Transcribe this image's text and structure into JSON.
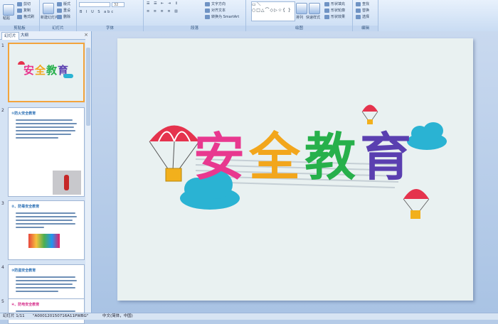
{
  "ribbon": {
    "clipboard": {
      "paste": "粘贴",
      "cut": "剪切",
      "copy": "复制",
      "format_painter": "格式刷",
      "group": "剪贴板"
    },
    "slides": {
      "new_slide": "新建幻灯片",
      "layout": "版式",
      "reset": "重设",
      "delete": "删除",
      "group": "幻灯片"
    },
    "font": {
      "font_size": "32",
      "group": "字体"
    },
    "paragraph": {
      "text_direction": "文字方向",
      "align_text": "对齐文本",
      "smartart": "转换为 SmartArt",
      "group": "段落"
    },
    "drawing": {
      "shapes_glyphs": "▭＼○□△⌒◇▷☆{ }",
      "arrange": "排列",
      "quick_styles": "快速样式",
      "shape_fill": "形状填充",
      "shape_outline": "形状轮廓",
      "shape_effects": "形状效果",
      "group": "绘图"
    },
    "editing": {
      "find": "查找",
      "replace": "替换",
      "select": "选择",
      "group": "编辑"
    }
  },
  "pane": {
    "tabs": [
      "幻灯片",
      "大纲"
    ],
    "close": "×",
    "slides": [
      {
        "num": "1",
        "title": "安全教育"
      },
      {
        "num": "2",
        "title": "①防火安全教育"
      },
      {
        "num": "3",
        "title": "②、防毒安全教育"
      },
      {
        "num": "4",
        "title": "③防盗安全教育"
      },
      {
        "num": "5",
        "title": "④、防电安全教育"
      }
    ]
  },
  "slide": {
    "title_chars": [
      "安",
      "全",
      "教",
      "育"
    ],
    "colors": {
      "an": "#e8388f",
      "quan": "#f2a61c",
      "jiao": "#27b04b",
      "yu": "#5a3fb0",
      "cloud": "#2ab3d3",
      "parachute": "#e5334d"
    }
  },
  "status": {
    "slide_count": "幻灯片 1/11",
    "theme": "\"A000120150716A11PWBG\"",
    "language": "中文(简体，中国)"
  }
}
